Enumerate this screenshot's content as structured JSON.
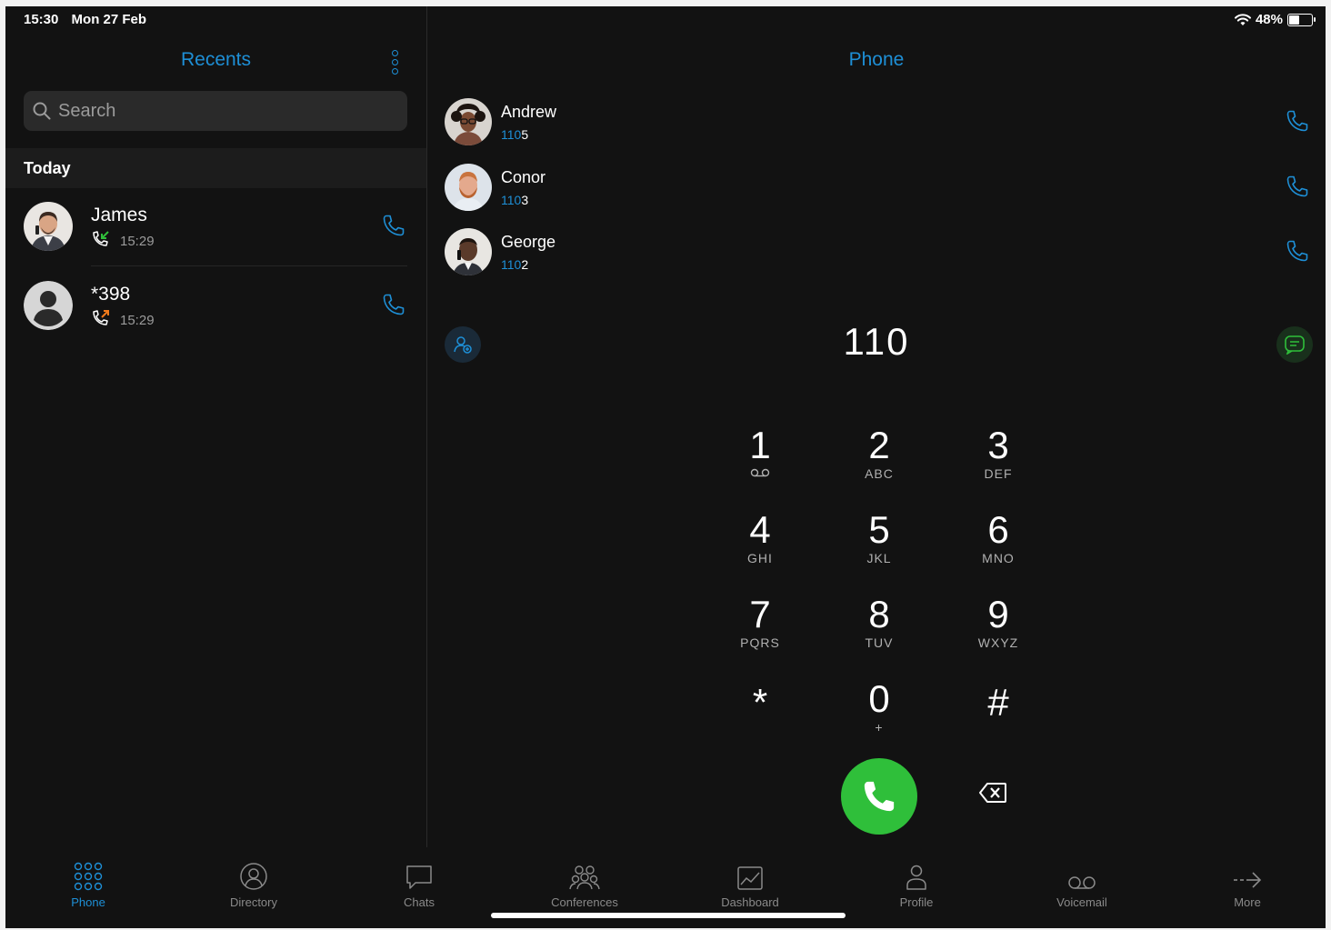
{
  "status": {
    "time": "15:30",
    "date": "Mon 27 Feb",
    "battery": "48%",
    "battery_level": 0.48
  },
  "recents": {
    "title": "Recents",
    "search_placeholder": "Search",
    "section": "Today",
    "items": [
      {
        "name": "James",
        "time": "15:29",
        "direction": "incoming",
        "avatar": "photo"
      },
      {
        "name": "*398",
        "time": "15:29",
        "direction": "outgoing",
        "avatar": "placeholder"
      }
    ]
  },
  "phone": {
    "title": "Phone",
    "dialed": "110",
    "suggestions": [
      {
        "name": "Andrew",
        "match": "110",
        "rest": "5"
      },
      {
        "name": "Conor",
        "match": "110",
        "rest": "3"
      },
      {
        "name": "George",
        "match": "110",
        "rest": "2"
      }
    ],
    "keypad": [
      {
        "digit": "1",
        "letters": ""
      },
      {
        "digit": "2",
        "letters": "ABC"
      },
      {
        "digit": "3",
        "letters": "DEF"
      },
      {
        "digit": "4",
        "letters": "GHI"
      },
      {
        "digit": "5",
        "letters": "JKL"
      },
      {
        "digit": "6",
        "letters": "MNO"
      },
      {
        "digit": "7",
        "letters": "PQRS"
      },
      {
        "digit": "8",
        "letters": "TUV"
      },
      {
        "digit": "9",
        "letters": "WXYZ"
      },
      {
        "digit": "*",
        "letters": ""
      },
      {
        "digit": "0",
        "letters": "+"
      },
      {
        "digit": "#",
        "letters": ""
      }
    ]
  },
  "tabs": [
    {
      "label": "Phone",
      "icon": "dialpad-icon",
      "active": true
    },
    {
      "label": "Directory",
      "icon": "directory-icon"
    },
    {
      "label": "Chats",
      "icon": "chat-icon"
    },
    {
      "label": "Conferences",
      "icon": "conferences-icon"
    },
    {
      "label": "Dashboard",
      "icon": "dashboard-icon"
    },
    {
      "label": "Profile",
      "icon": "profile-icon"
    },
    {
      "label": "Voicemail",
      "icon": "voicemail-icon"
    },
    {
      "label": "More",
      "icon": "more-arrow-icon"
    }
  ],
  "colors": {
    "accent": "#1e8fd6",
    "call_green": "#2fbf3a",
    "incoming": "#2fbf3a",
    "outgoing": "#f07a1a",
    "background": "#121212"
  }
}
